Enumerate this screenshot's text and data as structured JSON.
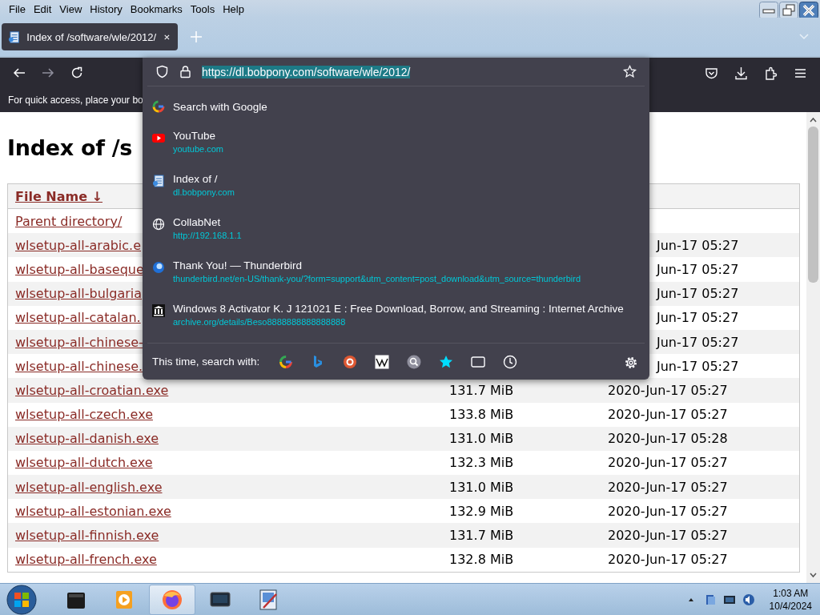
{
  "menu_bar": [
    "File",
    "Edit",
    "View",
    "History",
    "Bookmarks",
    "Tools",
    "Help"
  ],
  "tabs": [
    {
      "title": "Index of /software/wle/2012/",
      "selected": true
    }
  ],
  "address_bar": {
    "url": "https://dl.bobpony.com/software/wle/2012/",
    "selected": true
  },
  "bookmarks_bar": {
    "hint": "For quick access, place your bo"
  },
  "suggestions": [
    {
      "kind": "google",
      "title": "Search with Google"
    },
    {
      "kind": "youtube",
      "title": "YouTube",
      "url": "youtube.com"
    },
    {
      "kind": "page",
      "title": "Index of /",
      "url": "dl.bobpony.com"
    },
    {
      "kind": "globe",
      "title": "CollabNet",
      "url": "http://192.168.1.1"
    },
    {
      "kind": "thunderbird",
      "title": "Thank You! — Thunderbird",
      "url": "thunderbird.net/en-US/thank-you/?form=support&utm_content=post_download&utm_source=thunderbird"
    },
    {
      "kind": "archive",
      "title": "Windows 8 Activator K. J 121021 E : Free Download, Borrow, and Streaming : Internet Archive",
      "url": "archive.org/details/Beso8888888888888888"
    }
  ],
  "search_with_label": "This time, search with:",
  "page": {
    "heading": "Index of /s",
    "table": {
      "columns": [
        "File Name  ↓"
      ],
      "rows": [
        {
          "name": "Parent directory/"
        },
        {
          "name": "wlsetup-all-arabic.e",
          "date": "Jun-17 05:27"
        },
        {
          "name": "wlsetup-all-baseque",
          "date": "Jun-17 05:27"
        },
        {
          "name": "wlsetup-all-bulgaria",
          "date": "Jun-17 05:27"
        },
        {
          "name": "wlsetup-all-catalan.",
          "date": "Jun-17 05:27"
        },
        {
          "name": "wlsetup-all-chinese-",
          "date": "Jun-17 05:27"
        },
        {
          "name": "wlsetup-all-chinese.",
          "date": "Jun-17 05:27"
        },
        {
          "name": "wlsetup-all-croatian.exe",
          "size": "131.7 MiB",
          "date": "2020-Jun-17 05:27"
        },
        {
          "name": "wlsetup-all-czech.exe",
          "size": "133.8 MiB",
          "date": "2020-Jun-17 05:27"
        },
        {
          "name": "wlsetup-all-danish.exe",
          "size": "131.0 MiB",
          "date": "2020-Jun-17 05:28"
        },
        {
          "name": "wlsetup-all-dutch.exe",
          "size": "132.3 MiB",
          "date": "2020-Jun-17 05:27"
        },
        {
          "name": "wlsetup-all-english.exe",
          "size": "131.0 MiB",
          "date": "2020-Jun-17 05:27"
        },
        {
          "name": "wlsetup-all-estonian.exe",
          "size": "132.9 MiB",
          "date": "2020-Jun-17 05:27"
        },
        {
          "name": "wlsetup-all-finnish.exe",
          "size": "131.7 MiB",
          "date": "2020-Jun-17 05:27"
        },
        {
          "name": "wlsetup-all-french.exe",
          "size": "132.8 MiB",
          "date": "2020-Jun-17 05:27"
        }
      ]
    }
  },
  "taskbar": {
    "apps": [
      {
        "kind": "explorer",
        "selected": false
      },
      {
        "kind": "media",
        "selected": false
      },
      {
        "kind": "firefox",
        "selected": true
      },
      {
        "kind": "terminal",
        "selected": false
      },
      {
        "kind": "paint",
        "selected": false
      }
    ],
    "clock": {
      "time": "1:03 AM",
      "date": "10/4/2024"
    }
  }
}
